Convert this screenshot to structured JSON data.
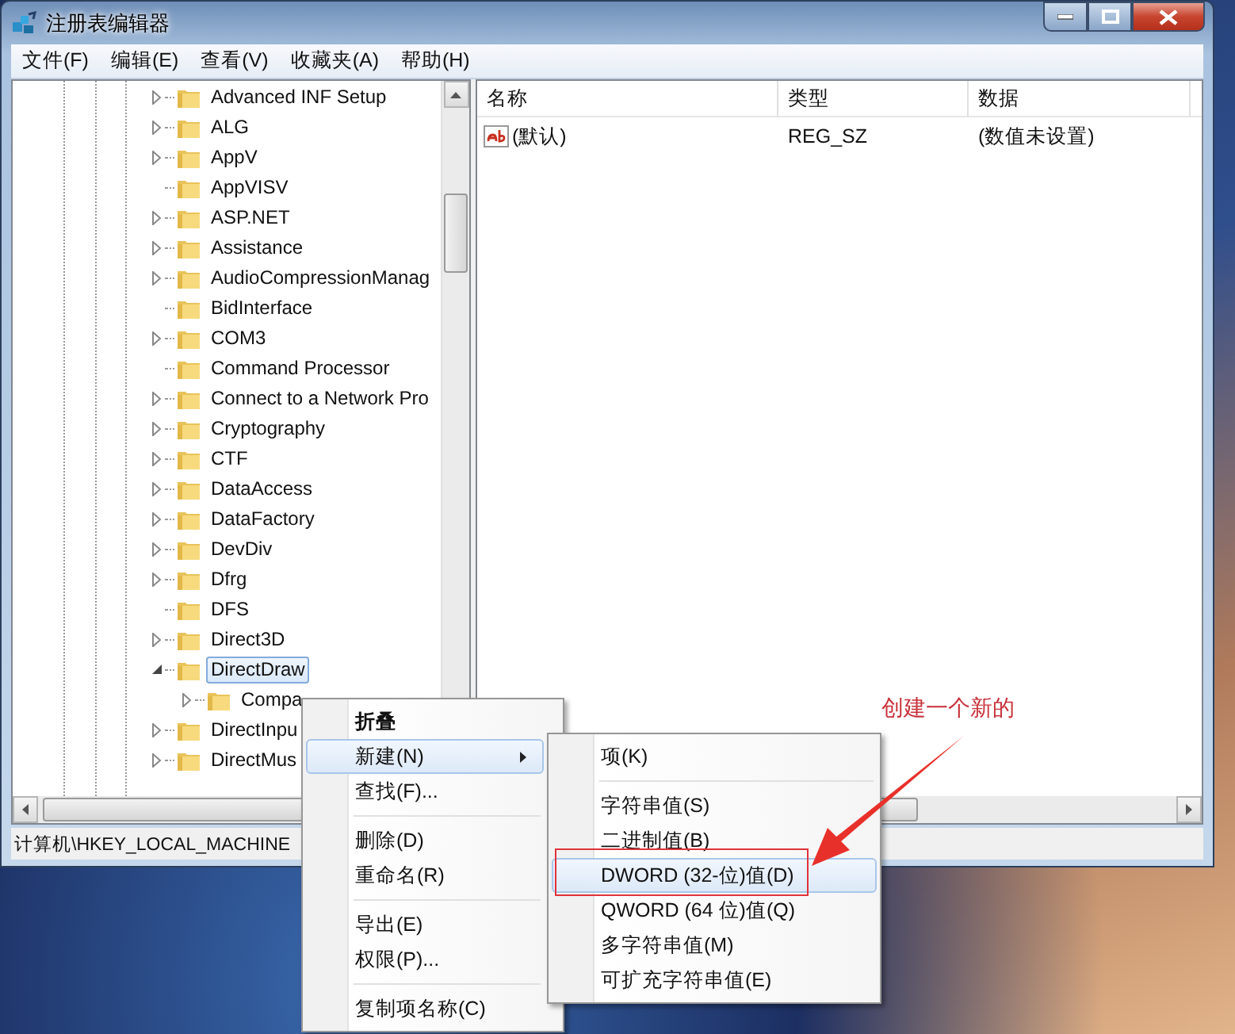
{
  "window": {
    "title": "注册表编辑器"
  },
  "menu_bar": [
    "文件(F)",
    "编辑(E)",
    "查看(V)",
    "收藏夹(A)",
    "帮助(H)"
  ],
  "tree": [
    {
      "label": "Advanced INF Setup",
      "kind": "branch",
      "expanded": false,
      "selected": false
    },
    {
      "label": "ALG",
      "kind": "branch",
      "expanded": false,
      "selected": false
    },
    {
      "label": "AppV",
      "kind": "branch",
      "expanded": false,
      "selected": false
    },
    {
      "label": "AppVISV",
      "kind": "leaf",
      "selected": false
    },
    {
      "label": "ASP.NET",
      "kind": "branch",
      "expanded": false,
      "selected": false
    },
    {
      "label": "Assistance",
      "kind": "branch",
      "expanded": false,
      "selected": false
    },
    {
      "label": "AudioCompressionManag",
      "kind": "branch",
      "expanded": false,
      "selected": false
    },
    {
      "label": "BidInterface",
      "kind": "leaf",
      "selected": false
    },
    {
      "label": "COM3",
      "kind": "branch",
      "expanded": false,
      "selected": false
    },
    {
      "label": "Command Processor",
      "kind": "leaf",
      "selected": false
    },
    {
      "label": "Connect to a Network Pro",
      "kind": "branch",
      "expanded": false,
      "selected": false
    },
    {
      "label": "Cryptography",
      "kind": "branch",
      "expanded": false,
      "selected": false
    },
    {
      "label": "CTF",
      "kind": "branch",
      "expanded": false,
      "selected": false
    },
    {
      "label": "DataAccess",
      "kind": "branch",
      "expanded": false,
      "selected": false
    },
    {
      "label": "DataFactory",
      "kind": "branch",
      "expanded": false,
      "selected": false
    },
    {
      "label": "DevDiv",
      "kind": "branch",
      "expanded": false,
      "selected": false
    },
    {
      "label": "Dfrg",
      "kind": "branch",
      "expanded": false,
      "selected": false
    },
    {
      "label": "DFS",
      "kind": "leaf",
      "selected": false
    },
    {
      "label": "Direct3D",
      "kind": "branch",
      "expanded": false,
      "selected": false
    },
    {
      "label": "DirectDraw",
      "kind": "branch",
      "expanded": true,
      "selected": true,
      "children": [
        {
          "label": "Compa",
          "kind": "branch",
          "expanded": false,
          "selected": false
        }
      ]
    },
    {
      "label": "DirectInpu",
      "kind": "branch",
      "expanded": false,
      "selected": false
    },
    {
      "label": "DirectMus",
      "kind": "branch",
      "expanded": false,
      "selected": false
    }
  ],
  "values": {
    "columns": [
      "名称",
      "类型",
      "数据"
    ],
    "rows": [
      {
        "name": "(默认)",
        "type": "REG_SZ",
        "data": "(数值未设置)"
      }
    ]
  },
  "status_bar": "计算机\\HKEY_LOCAL_MACHINE",
  "context_menu": {
    "items": [
      {
        "kind": "item",
        "label": "折叠",
        "default": true,
        "selected": false,
        "submenu": false
      },
      {
        "kind": "item",
        "label": "新建(N)",
        "default": false,
        "selected": true,
        "submenu": true
      },
      {
        "kind": "item",
        "label": "查找(F)...",
        "default": false,
        "selected": false,
        "submenu": false
      },
      {
        "kind": "separator"
      },
      {
        "kind": "item",
        "label": "删除(D)",
        "default": false,
        "selected": false,
        "submenu": false
      },
      {
        "kind": "item",
        "label": "重命名(R)",
        "default": false,
        "selected": false,
        "submenu": false
      },
      {
        "kind": "separator"
      },
      {
        "kind": "item",
        "label": "导出(E)",
        "default": false,
        "selected": false,
        "submenu": false
      },
      {
        "kind": "item",
        "label": "权限(P)...",
        "default": false,
        "selected": false,
        "submenu": false
      },
      {
        "kind": "separator"
      },
      {
        "kind": "item",
        "label": "复制项名称(C)",
        "default": false,
        "selected": false,
        "submenu": false
      }
    ]
  },
  "submenu": {
    "items": [
      {
        "kind": "item",
        "label": "项(K)",
        "selected": false
      },
      {
        "kind": "separator"
      },
      {
        "kind": "item",
        "label": "字符串值(S)",
        "selected": false
      },
      {
        "kind": "item",
        "label": "二进制值(B)",
        "selected": false
      },
      {
        "kind": "item",
        "label": "DWORD (32-位)值(D)",
        "selected": true
      },
      {
        "kind": "item",
        "label": "QWORD (64 位)值(Q)",
        "selected": false
      },
      {
        "kind": "item",
        "label": "多字符串值(M)",
        "selected": false
      },
      {
        "kind": "item",
        "label": "可扩充字符串值(E)",
        "selected": false
      }
    ]
  },
  "annotation": {
    "text": "创建一个新的"
  }
}
